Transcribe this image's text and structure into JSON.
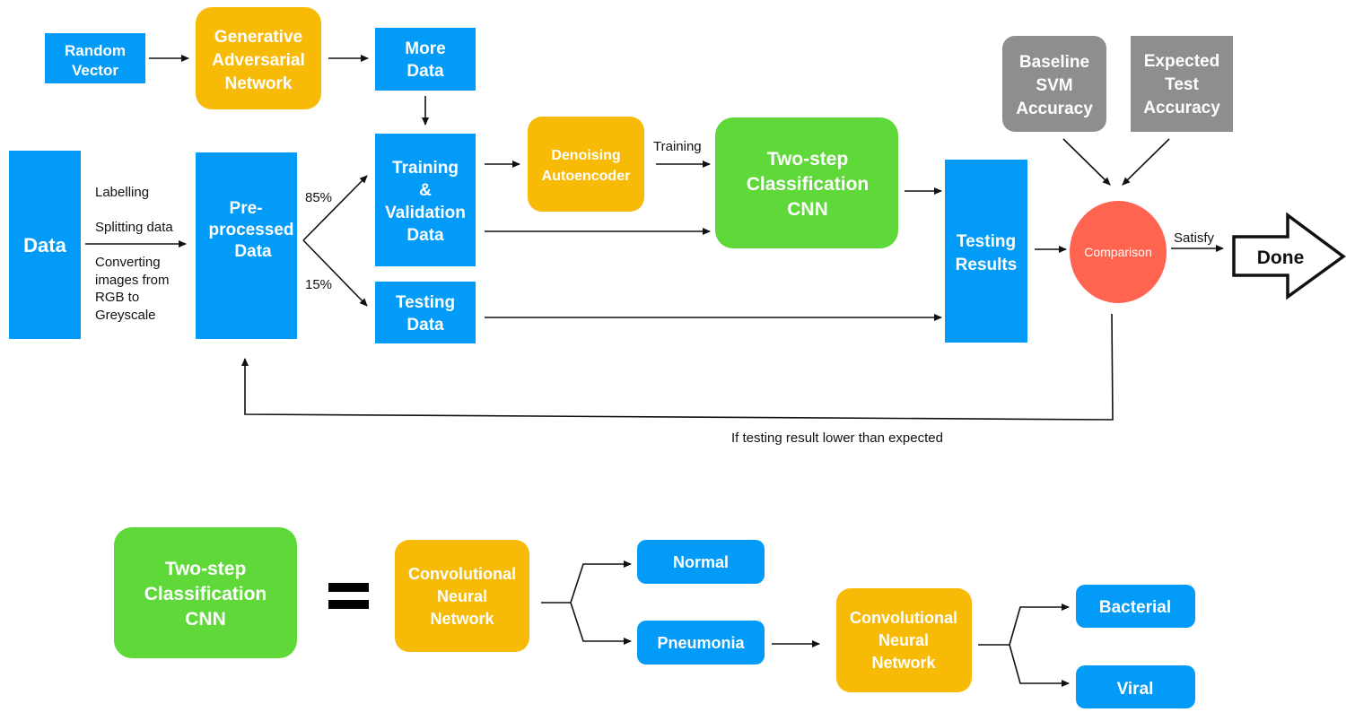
{
  "colors": {
    "blue": "#039BF8",
    "orange": "#F7BA07",
    "green": "#5FD93A",
    "gray": "#8E8E8E",
    "red": "#FE6450",
    "line": "#111111"
  },
  "top": {
    "random_vector": [
      "Random",
      "Vector"
    ],
    "gan": [
      "Generative",
      "Adversarial",
      "Network"
    ],
    "more_data": [
      "More",
      "Data"
    ],
    "data": [
      "Data"
    ],
    "preprocessing_steps": [
      "Labelling",
      "Splitting data",
      "Converting",
      "images from",
      "RGB to",
      "Greyscale"
    ],
    "preprocessed": [
      "Pre-",
      "processed",
      "Data"
    ],
    "split_train": "85%",
    "split_test": "15%",
    "train_val": [
      "Training",
      "&",
      "Validation",
      "Data"
    ],
    "testing_data": [
      "Testing",
      "Data"
    ],
    "denoising": [
      "Denoising",
      "Autoencoder"
    ],
    "training_label": "Training",
    "two_step": [
      "Two-step",
      "Classification",
      "CNN"
    ],
    "testing_results": [
      "Testing",
      "Results"
    ],
    "baseline": [
      "Baseline",
      "SVM",
      "Accuracy"
    ],
    "expected": [
      "Expected",
      "Test",
      "Accuracy"
    ],
    "comparison": "Comparison",
    "satisfy": "Satisfy",
    "done": "Done",
    "feedback_label": "If testing result lower than expected"
  },
  "bottom": {
    "two_step": [
      "Two-step",
      "Classification",
      "CNN"
    ],
    "equals": "=",
    "cnn1": [
      "Convolutional",
      "Neural",
      "Network"
    ],
    "normal": "Normal",
    "pneumonia": "Pneumonia",
    "cnn2": [
      "Convolutional",
      "Neural",
      "Network"
    ],
    "bacterial": "Bacterial",
    "viral": "Viral"
  }
}
